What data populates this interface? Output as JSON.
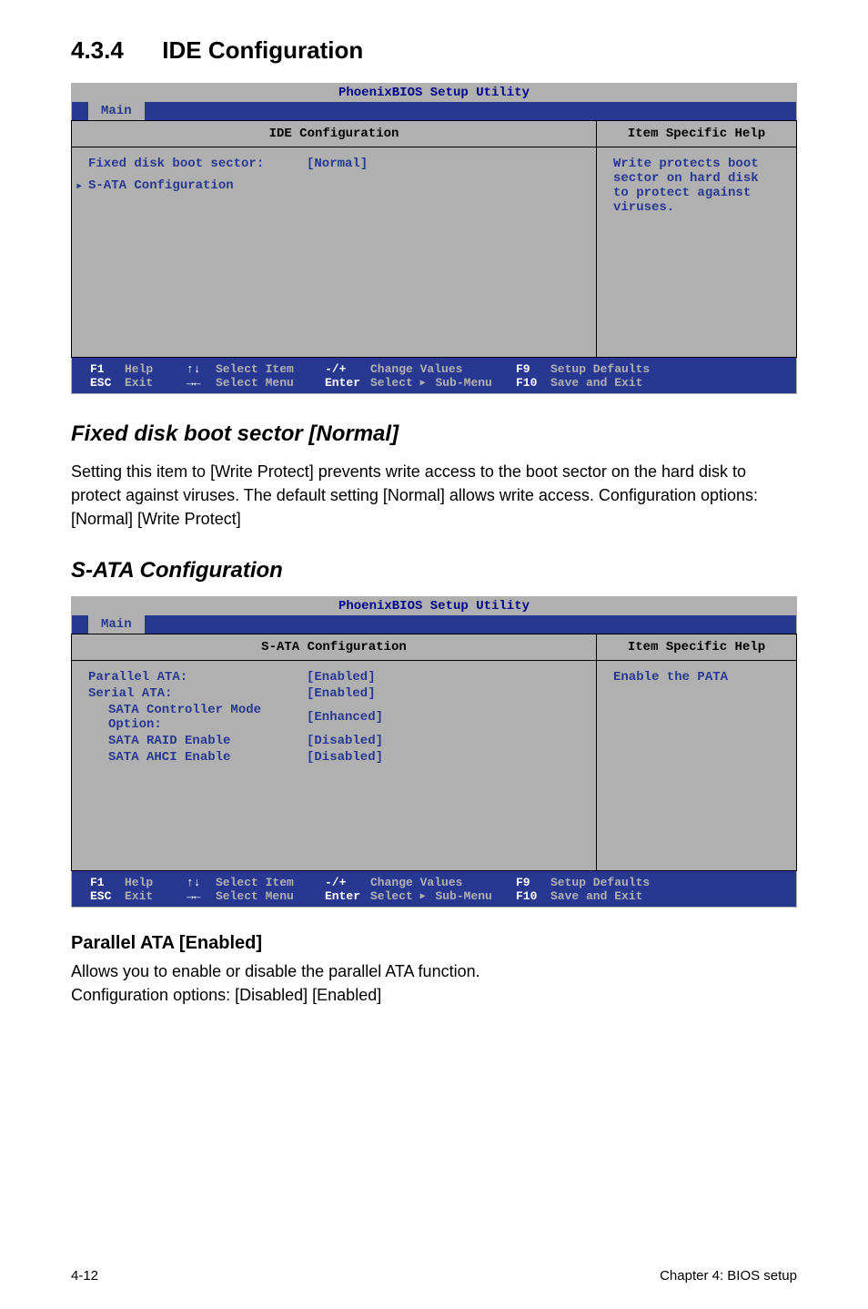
{
  "section_number": "4.3.4",
  "section_title": "IDE Configuration",
  "bios1": {
    "utility_title": "PhoenixBIOS Setup Utility",
    "tab": "Main",
    "panel_title": "IDE Configuration",
    "help_title": "Item Specific Help",
    "help_text": "Write protects boot sector on hard disk to protect against viruses.",
    "rows": [
      {
        "label": "Fixed disk boot sector:",
        "value": "[Normal]"
      }
    ],
    "submenu": "S-ATA Configuration"
  },
  "bios2": {
    "utility_title": "PhoenixBIOS Setup Utility",
    "tab": "Main",
    "panel_title": "S-ATA Configuration",
    "help_title": "Item Specific Help",
    "help_text": "Enable the PATA",
    "rows": [
      {
        "label": "Parallel ATA:",
        "indent": false,
        "value": "[Enabled]"
      },
      {
        "label": "Serial ATA:",
        "indent": false,
        "value": "[Enabled]"
      },
      {
        "label": "SATA Controller Mode Option:",
        "indent": true,
        "value": "[Enhanced]"
      },
      {
        "label": "SATA RAID Enable",
        "indent": true,
        "value": "[Disabled]"
      },
      {
        "label": "SATA AHCI Enable",
        "indent": true,
        "value": "[Disabled]"
      }
    ]
  },
  "foot": {
    "f1": "F1",
    "f1l": "Help",
    "updown": "↑↓",
    "updownl": "Select Item",
    "pm": "-/+",
    "pml": "Change Values",
    "f9": "F9",
    "f9l": "Setup Defaults",
    "esc": "ESC",
    "escl": "Exit",
    "lr": "→←",
    "lrl": "Select Menu",
    "ent": "Enter",
    "entl_pre": "Select ",
    "entl_arrow": "▶",
    "entl_post": " Sub-Menu",
    "f10": "F10",
    "f10l": "Save and Exit"
  },
  "sub1_heading": "Fixed disk boot sector [Normal]",
  "sub1_body": "Setting this item to [Write Protect] prevents write access to the boot sector on the hard disk to protect against viruses. The default setting [Normal] allows write access. Configuration options: [Normal] [Write Protect]",
  "sub2_heading": "S-ATA Configuration",
  "sub3_heading": "Parallel ATA [Enabled]",
  "sub3_body1": "Allows you to enable or disable the parallel ATA function.",
  "sub3_body2": "Configuration options: [Disabled] [Enabled]",
  "footer_left": "4-12",
  "footer_right": "Chapter 4: BIOS setup"
}
